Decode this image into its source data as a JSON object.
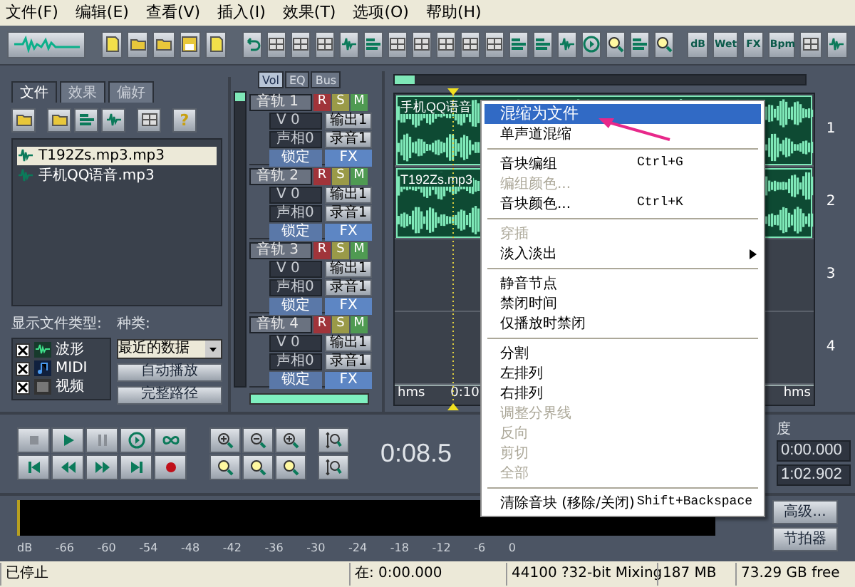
{
  "menu_bar": [
    "文件(F)",
    "编辑(E)",
    "查看(V)",
    "插入(I)",
    "效果(T)",
    "选项(O)",
    "帮助(H)"
  ],
  "toolbar": {
    "labeled_buttons": [
      "dB",
      "Wet",
      "FX",
      "Bpm"
    ]
  },
  "file_panel": {
    "tabs": [
      {
        "label": "文件",
        "selected": true
      },
      {
        "label": "效果",
        "selected": false
      },
      {
        "label": "偏好",
        "selected": false
      }
    ],
    "help_button": "?",
    "files": [
      {
        "name": "T192Zs.mp3.mp3",
        "selected": true
      },
      {
        "name": "手机QQ语音.mp3",
        "selected": false
      }
    ],
    "show_types_label": "显示文件类型:",
    "types": [
      {
        "label": "波形",
        "checked": true,
        "kind": "wave"
      },
      {
        "label": "MIDI",
        "checked": true,
        "kind": "midi"
      },
      {
        "label": "视频",
        "checked": true,
        "kind": "video"
      }
    ],
    "category_label": "种类:",
    "category_value": "最近的数据",
    "buttons": [
      "自动播放",
      "完整路径"
    ]
  },
  "mixer": {
    "tabs": [
      {
        "label": "Vol",
        "selected": true
      },
      {
        "label": "EQ",
        "selected": false
      },
      {
        "label": "Bus",
        "selected": false
      }
    ],
    "tracks": [
      {
        "name": "音轨 1",
        "record": "R",
        "solo": "S",
        "mute": "M",
        "volume": "V 0",
        "output": "输出1",
        "pan": "声相0",
        "input": "录音1",
        "lock": "锁定",
        "fx": "FX"
      },
      {
        "name": "音轨 2",
        "record": "R",
        "solo": "S",
        "mute": "M",
        "volume": "V 0",
        "output": "输出1",
        "pan": "声相0",
        "input": "录音1",
        "lock": "锁定",
        "fx": "FX"
      },
      {
        "name": "音轨 3",
        "record": "R",
        "solo": "S",
        "mute": "M",
        "volume": "V 0",
        "output": "输出1",
        "pan": "声相0",
        "input": "录音1",
        "lock": "锁定",
        "fx": "FX"
      },
      {
        "name": "音轨 4",
        "record": "R",
        "solo": "S",
        "mute": "M",
        "volume": "V 0",
        "output": "输出1",
        "pan": "声相0",
        "input": "录音1",
        "lock": "锁定",
        "fx": "FX"
      }
    ]
  },
  "multitrack": {
    "tracks": [
      {
        "number": "1",
        "clip": "手机QQ语音"
      },
      {
        "number": "2",
        "clip": "T192Zs.mp3"
      },
      {
        "number": "3"
      },
      {
        "number": "4"
      }
    ],
    "ruler": [
      "hms",
      "0:10",
      "hms"
    ]
  },
  "context_menu": [
    {
      "kind": "item",
      "label": "混缩为文件",
      "selected": true,
      "disabled": false
    },
    {
      "kind": "item",
      "label": "单声道混缩",
      "selected": false,
      "disabled": false
    },
    {
      "kind": "separator"
    },
    {
      "kind": "item",
      "label": "音块编组",
      "shortcut": "Ctrl+G",
      "selected": false,
      "disabled": false
    },
    {
      "kind": "item",
      "label": "编组颜色...",
      "selected": false,
      "disabled": true
    },
    {
      "kind": "item",
      "label": "音块颜色...",
      "shortcut": "Ctrl+K",
      "selected": false,
      "disabled": false
    },
    {
      "kind": "separator"
    },
    {
      "kind": "item",
      "label": "穿插",
      "selected": false,
      "disabled": true
    },
    {
      "kind": "item",
      "label": "淡入淡出",
      "submenu": true,
      "selected": false,
      "disabled": false
    },
    {
      "kind": "separator"
    },
    {
      "kind": "item",
      "label": "静音节点",
      "selected": false,
      "disabled": false
    },
    {
      "kind": "item",
      "label": "禁闭时间",
      "selected": false,
      "disabled": false
    },
    {
      "kind": "item",
      "label": "仅播放时禁闭",
      "selected": false,
      "disabled": false
    },
    {
      "kind": "separator"
    },
    {
      "kind": "item",
      "label": "分割",
      "selected": false,
      "disabled": false
    },
    {
      "kind": "item",
      "label": "左排列",
      "selected": false,
      "disabled": false
    },
    {
      "kind": "item",
      "label": "右排列",
      "selected": false,
      "disabled": false
    },
    {
      "kind": "item",
      "label": "调整分界线",
      "selected": false,
      "disabled": true
    },
    {
      "kind": "item",
      "label": "反向",
      "selected": false,
      "disabled": true
    },
    {
      "kind": "item",
      "label": "剪切",
      "selected": false,
      "disabled": true
    },
    {
      "kind": "item",
      "label": "全部",
      "selected": false,
      "disabled": true
    },
    {
      "kind": "separator"
    },
    {
      "kind": "item",
      "label": "清除音块 (移除/关闭)",
      "shortcut": "Shift+Backspace",
      "selected": false,
      "disabled": false
    }
  ],
  "transport": {
    "time": "0:08.5",
    "length_label": "度",
    "fields": [
      "0:00.000",
      "1:02.902"
    ],
    "buttons": [
      "高级...",
      "节拍器"
    ]
  },
  "meter": {
    "scale": [
      "dB",
      "-66",
      "-60",
      "-54",
      "-48",
      "-42",
      "-36",
      "-30",
      "-24",
      "-18",
      "-12",
      "-6",
      "0"
    ]
  },
  "status_bar": [
    "已停止",
    "在: 0:00.000",
    "44100 ?32-bit Mixing",
    "187 MB",
    "73.29 GB free"
  ]
}
